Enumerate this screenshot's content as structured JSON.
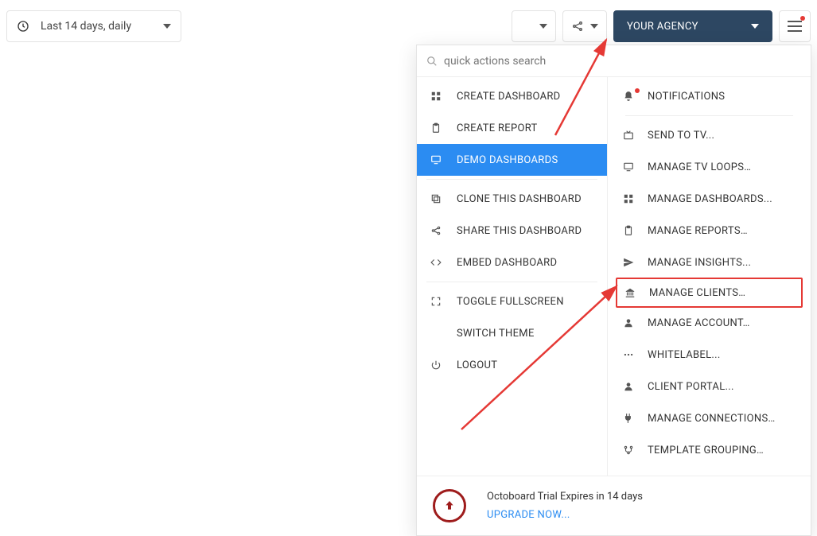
{
  "toolbar": {
    "date_label": "Last 14 days, daily",
    "agency_label": "YOUR AGENCY"
  },
  "search": {
    "placeholder": "quick actions search"
  },
  "left_menu": [
    {
      "icon": "grid",
      "label": "CREATE DASHBOARD"
    },
    {
      "icon": "clipboard",
      "label": "CREATE REPORT"
    },
    {
      "icon": "monitor",
      "label": "DEMO DASHBOARDS",
      "active": true
    },
    {
      "sep": true
    },
    {
      "icon": "copy",
      "label": "CLONE THIS DASHBOARD"
    },
    {
      "icon": "share",
      "label": "SHARE THIS DASHBOARD"
    },
    {
      "icon": "code",
      "label": "EMBED DASHBOARD"
    },
    {
      "sep": true
    },
    {
      "icon": "fullscreen",
      "label": "TOGGLE FULLSCREEN"
    },
    {
      "icon": "theme",
      "label": "SWITCH THEME"
    },
    {
      "icon": "power",
      "label": "LOGOUT"
    }
  ],
  "right_menu": [
    {
      "icon": "bell",
      "label": "NOTIFICATIONS",
      "dot": true
    },
    {
      "sep": true
    },
    {
      "icon": "tv",
      "label": "SEND TO TV..."
    },
    {
      "icon": "monitor",
      "label": "MANAGE TV LOOPS…"
    },
    {
      "icon": "grid",
      "label": "MANAGE DASHBOARDS..."
    },
    {
      "icon": "clipboard",
      "label": "MANAGE REPORTS…"
    },
    {
      "icon": "send",
      "label": "MANAGE INSIGHTS..."
    },
    {
      "icon": "bank",
      "label": "MANAGE CLIENTS…",
      "boxed": true
    },
    {
      "icon": "user",
      "label": "MANAGE ACCOUNT…"
    },
    {
      "icon": "dots",
      "label": "WHITELABEL..."
    },
    {
      "icon": "user",
      "label": "CLIENT PORTAL..."
    },
    {
      "icon": "plug",
      "label": "MANAGE CONNECTIONS…"
    },
    {
      "icon": "branch",
      "label": "TEMPLATE GROUPING…"
    }
  ],
  "footer": {
    "line1": "Octoboard Trial Expires in 14 days",
    "line2": "UPGRADE NOW..."
  }
}
